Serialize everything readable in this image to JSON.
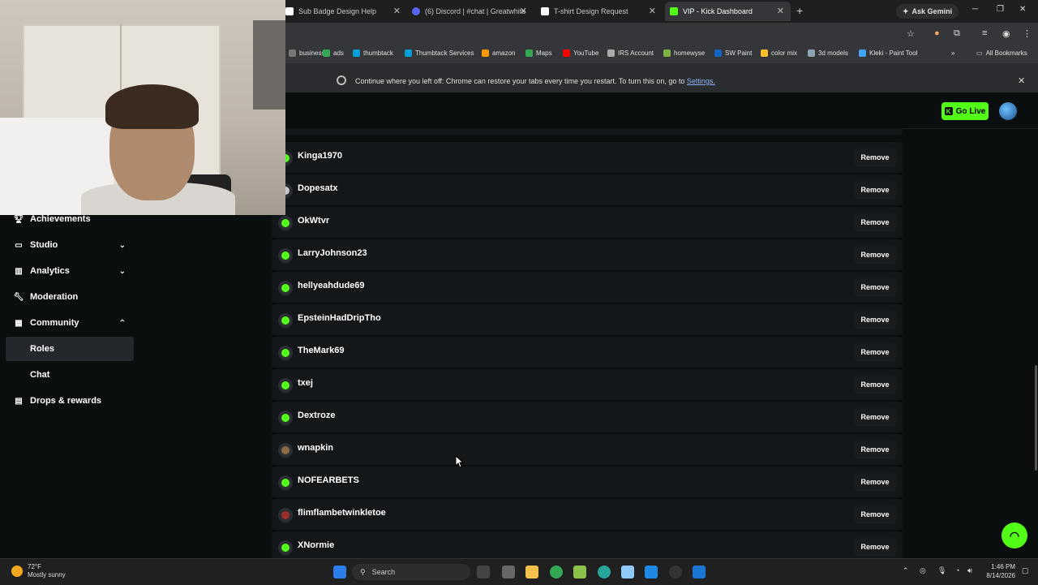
{
  "browser": {
    "tabs": [
      {
        "title": "Sub Badge Design Help",
        "color": "#ffffff"
      },
      {
        "title": "(6) Discord | #chat | Greatwhite",
        "color": "#5865f2"
      },
      {
        "title": "T-shirt Design Request",
        "color": "#ffffff"
      },
      {
        "title": "VIP - Kick Dashboard",
        "color": "#53fc18",
        "active": true
      }
    ],
    "new_tab": "+",
    "ask_gemini": "Ask Gemini",
    "bookmarks": [
      {
        "label": "business",
        "color": "#777"
      },
      {
        "label": "ads",
        "color": "#34a853"
      },
      {
        "label": "thumbtack",
        "color": "#009fd9"
      },
      {
        "label": "Thumbtack Services",
        "color": "#009fd9"
      },
      {
        "label": "amazon",
        "color": "#ff9900"
      },
      {
        "label": "Maps",
        "color": "#34a853"
      },
      {
        "label": "YouTube",
        "color": "#ff0000"
      },
      {
        "label": "IRS Account",
        "color": "#aaaaaa"
      },
      {
        "label": "homewyse",
        "color": "#7cb342"
      },
      {
        "label": "SW Paint",
        "color": "#1565c0"
      },
      {
        "label": "color mix",
        "color": "#fbc02d"
      },
      {
        "label": "3d models",
        "color": "#90a4ae"
      },
      {
        "label": "Kleki - Paint Tool",
        "color": "#42a5f5"
      }
    ],
    "all_bookmarks": "All Bookmarks",
    "banner": {
      "text": "Continue where you left off: Chrome can restore your tabs every time you restart. To turn this on, go to",
      "link": "Settings."
    }
  },
  "header": {
    "go_live": "Go Live"
  },
  "sidebar": {
    "items": [
      {
        "label": "Achievements",
        "icon": "trophy-icon"
      },
      {
        "label": "Studio",
        "icon": "studio-icon",
        "chevron": "down"
      },
      {
        "label": "Analytics",
        "icon": "analytics-icon",
        "chevron": "down"
      },
      {
        "label": "Moderation",
        "icon": "wrench-icon"
      },
      {
        "label": "Community",
        "icon": "community-icon",
        "chevron": "up"
      }
    ],
    "sub_items": [
      {
        "label": "Roles",
        "selected": true
      },
      {
        "label": "Chat"
      }
    ],
    "drops": {
      "label": "Drops & rewards",
      "icon": "gift-icon"
    }
  },
  "vip_list": {
    "remove_label": "Remove",
    "users": [
      {
        "name": "Kinga1970",
        "avatar": "green"
      },
      {
        "name": "Dopesatx",
        "avatar": "dark"
      },
      {
        "name": "OkWtvr",
        "avatar": "green"
      },
      {
        "name": "LarryJohnson23",
        "avatar": "green"
      },
      {
        "name": "hellyeahdude69",
        "avatar": "green"
      },
      {
        "name": "EpsteinHadDripTho",
        "avatar": "green"
      },
      {
        "name": "TheMark69",
        "avatar": "green"
      },
      {
        "name": "txej",
        "avatar": "green"
      },
      {
        "name": "Dextroze",
        "avatar": "green"
      },
      {
        "name": "wnapkin",
        "avatar": "brown"
      },
      {
        "name": "NOFEARBETS",
        "avatar": "green"
      },
      {
        "name": "flimflambetwinkletoe",
        "avatar": "red"
      },
      {
        "name": "XNormie",
        "avatar": "green"
      }
    ]
  },
  "taskbar": {
    "weather_temp": "72°F",
    "weather_desc": "Mostly sunny",
    "search": "Search",
    "time": "1:46 PM",
    "date": "8/14/2026"
  },
  "accent": "#53fc18"
}
